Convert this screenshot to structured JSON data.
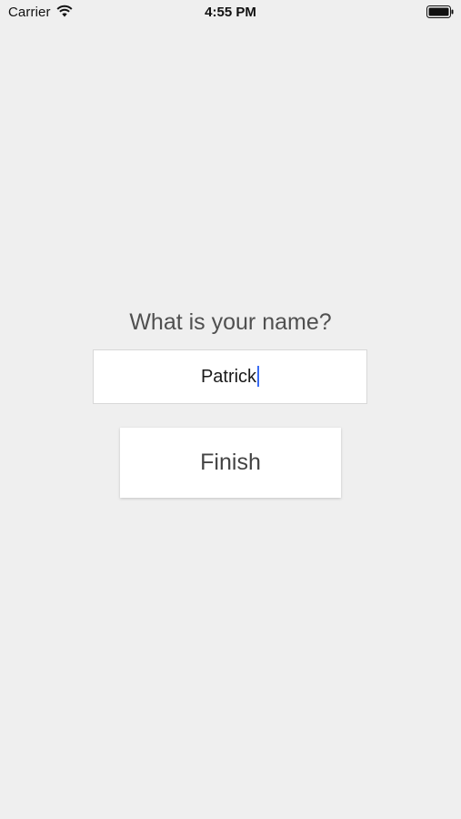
{
  "status_bar": {
    "carrier": "Carrier",
    "time": "4:55 PM",
    "wifi_icon": "wifi-icon",
    "battery_icon": "battery-icon"
  },
  "form": {
    "question": "What is your name?",
    "name_value": "Patrick",
    "finish_label": "Finish"
  },
  "colors": {
    "background": "#efefef",
    "caret": "#3a6cf4"
  }
}
